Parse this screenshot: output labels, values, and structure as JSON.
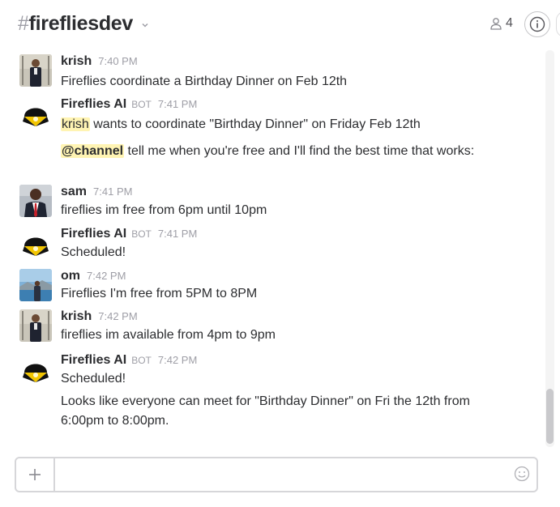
{
  "header": {
    "hash": "#",
    "channel_name": "firefliesdev",
    "member_count": "4"
  },
  "messages": [
    {
      "name": "krish",
      "time": "7:40 PM",
      "bot": "",
      "lines": [
        "Fireflies coordinate a Birthday Dinner on Feb 12th"
      ]
    },
    {
      "name": "Fireflies AI",
      "time": "7:41 PM",
      "bot": "BOT",
      "line1_mention": "krish",
      "line1_rest": " wants to coordinate \"Birthday Dinner\" on Friday Feb 12th",
      "line2_mention": "@channel",
      "line2_rest": " tell me when you're free and I'll find the best time that works:"
    },
    {
      "name": "sam",
      "time": "7:41 PM",
      "bot": "",
      "lines": [
        "fireflies im free from 6pm until 10pm"
      ]
    },
    {
      "name": "Fireflies AI",
      "time": "7:41 PM",
      "bot": "BOT",
      "lines": [
        "Scheduled!"
      ]
    },
    {
      "name": "om",
      "time": "7:42 PM",
      "bot": "",
      "lines": [
        "Fireflies I'm free from 5PM to 8PM"
      ]
    },
    {
      "name": "krish",
      "time": "7:42 PM",
      "bot": "",
      "lines": [
        "fireflies im available from 4pm to 9pm"
      ]
    },
    {
      "name": "Fireflies AI",
      "time": "7:42 PM",
      "bot": "BOT",
      "lines": [
        "Scheduled!",
        "Looks like everyone can meet for \"Birthday Dinner\" on Fri the 12th from",
        "6:00pm to 8:00pm."
      ]
    }
  ],
  "composer": {
    "value": "",
    "placeholder": ""
  },
  "colors": {
    "highlight": "#fff4b3",
    "text": "#2c2d30",
    "muted": "#9e9ea6",
    "border": "#d6d6d9"
  }
}
